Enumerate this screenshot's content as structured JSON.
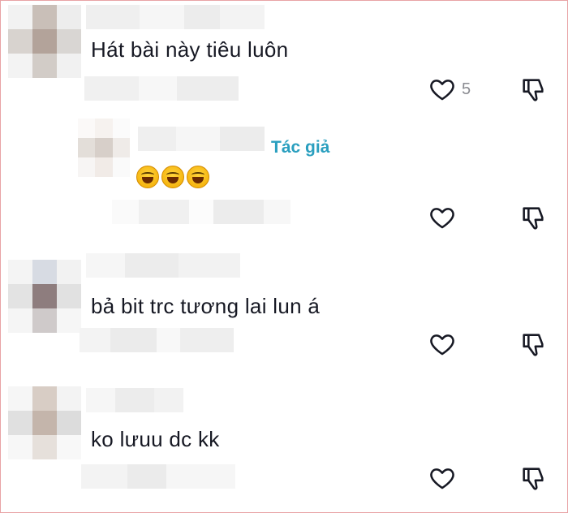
{
  "comments": [
    {
      "text": "Hát bài này tiêu luôn",
      "like_count": "5"
    },
    {
      "is_author": true,
      "author_badge": "Tác giả"
    },
    {
      "text": "bả bit trc tương lai lun á"
    },
    {
      "text": "ko lưuu dc kk"
    }
  ],
  "colors": {
    "text": "#161823",
    "author_badge": "#2a9fbf",
    "icon": "#161823",
    "count": "#8a8b91",
    "border": "#e8a3a6"
  },
  "icons": {
    "like": "heart-outline-icon",
    "dislike": "thumbs-down-outline-icon",
    "reaction": "laughing-emoji-icon"
  }
}
